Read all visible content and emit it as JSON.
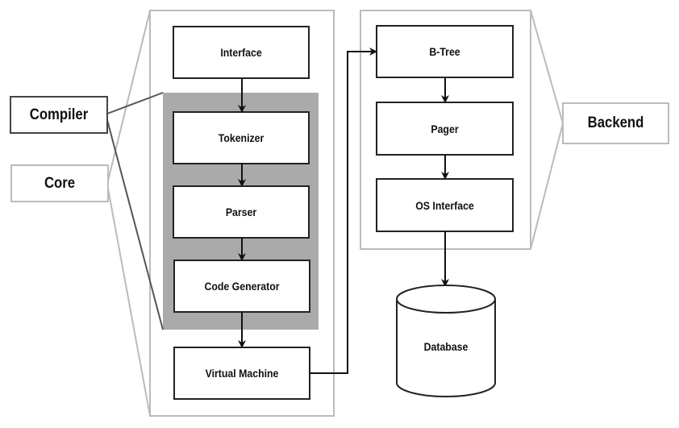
{
  "colors": {
    "compiler_group": "#aaaaaa",
    "outline_light": "#bbbbbb",
    "line_dark": "#222222"
  },
  "labels": {
    "compiler": "Compiler",
    "core": "Core",
    "backend": "Backend"
  },
  "core_modules": [
    "Interface",
    "Tokenizer",
    "Parser",
    "Code Generator",
    "Virtual Machine"
  ],
  "backend_modules": [
    "B-Tree",
    "Pager",
    "OS Interface"
  ],
  "storage": "Database"
}
